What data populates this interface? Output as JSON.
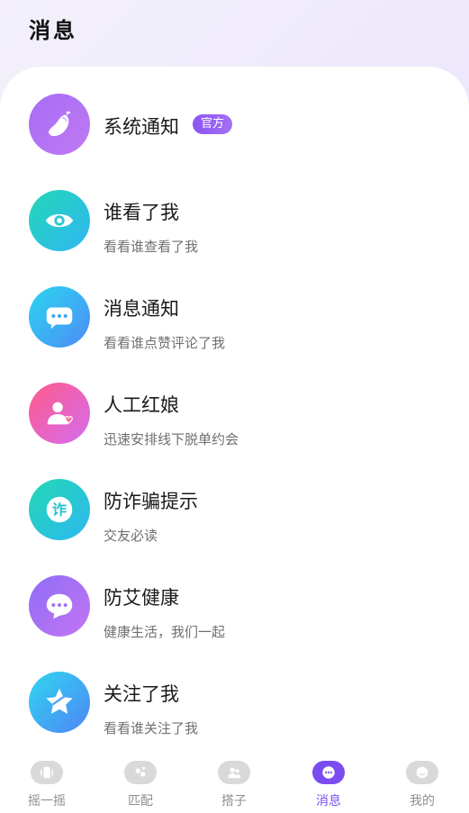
{
  "header": {
    "title": "消息"
  },
  "items": [
    {
      "title": "系统通知",
      "subtitle": "",
      "badge": "官方",
      "icon": "eggplant-icon",
      "gradient": [
        "#a66cf6",
        "#c07af2"
      ]
    },
    {
      "title": "谁看了我",
      "subtitle": "看看谁查看了我",
      "icon": "eye-icon",
      "gradient": [
        "#23d8b6",
        "#2fb6f3"
      ]
    },
    {
      "title": "消息通知",
      "subtitle": "看看谁点赞评论了我",
      "icon": "chat-bubble-icon",
      "gradient": [
        "#2ad6ef",
        "#4e8bf7"
      ]
    },
    {
      "title": "人工红娘",
      "subtitle": "迅速安排线下脱单约会",
      "icon": "person-heart-icon",
      "gradient": [
        "#ff5a8a",
        "#d46df0"
      ]
    },
    {
      "title": "防诈骗提示",
      "subtitle": "交友必读",
      "icon": "zha-text-icon",
      "gradient": [
        "#22d9b2",
        "#2eb7f2"
      ]
    },
    {
      "title": "防艾健康",
      "subtitle": "健康生活，我们一起",
      "icon": "chat-dots-icon",
      "gradient": [
        "#8f6df7",
        "#c375f2"
      ]
    },
    {
      "title": "关注了我",
      "subtitle": "看看谁关注了我",
      "icon": "star-icon",
      "gradient": [
        "#2fd6ef",
        "#4f85f6"
      ]
    }
  ],
  "zha_char": "诈",
  "tabs": [
    {
      "label": "摇一摇",
      "icon": "shake-icon",
      "active": false
    },
    {
      "label": "匹配",
      "icon": "match-icon",
      "active": false
    },
    {
      "label": "搭子",
      "icon": "partner-icon",
      "active": false
    },
    {
      "label": "消息",
      "icon": "message-icon",
      "active": true
    },
    {
      "label": "我的",
      "icon": "profile-icon",
      "active": false
    }
  ],
  "colors": {
    "accent": "#7b4df0",
    "inactive": "#8f8f8f"
  }
}
